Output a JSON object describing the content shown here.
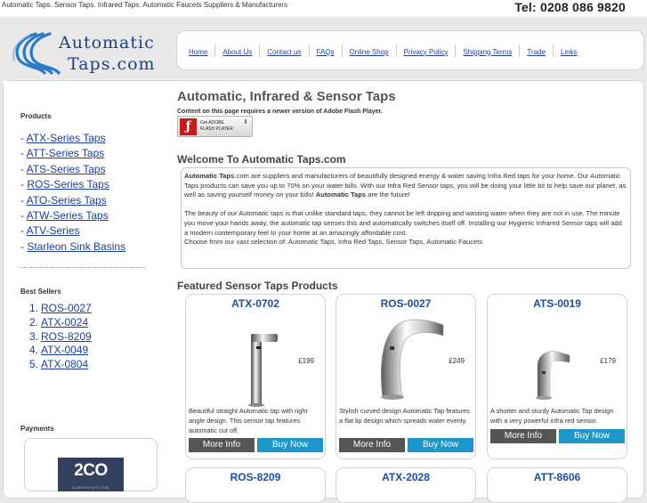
{
  "header": {
    "tagline": "Automatic Taps. Sensor Taps. Infrared Taps. Automatic Faucets Suppliers & Manufacturers",
    "phone": "Tel: 0208 086 9820"
  },
  "logo": {
    "line1": "Automatic",
    "line2": "Taps.com",
    "icon": "water-swoosh-logo"
  },
  "nav": {
    "items": [
      {
        "label": "Home"
      },
      {
        "label": "About Us"
      },
      {
        "label": "Contact us"
      },
      {
        "label": "FAQs"
      },
      {
        "label": "Online Shop"
      },
      {
        "label": "Privacy Policy"
      },
      {
        "label": "Shipping Terms"
      },
      {
        "label": "Trade"
      },
      {
        "label": "Links"
      }
    ]
  },
  "sidebar": {
    "products_title": "Products",
    "products": [
      {
        "prefix": "- ",
        "label": "ATX-Series Taps"
      },
      {
        "prefix": "- ",
        "label": "ATT-Series Taps"
      },
      {
        "prefix": "- ",
        "label": "ATS-Series Taps"
      },
      {
        "prefix": "- ",
        "label": "ROS-Series Taps"
      },
      {
        "prefix": "- ",
        "label": "ATO-Series Taps"
      },
      {
        "prefix": "- ",
        "label": "ATW-Series Taps"
      },
      {
        "prefix": "- ",
        "label": "ATV-Series "
      },
      {
        "prefix": "- ",
        "label": "Starleon Sink Basins"
      }
    ],
    "best_title": "Best Sellers",
    "best": [
      {
        "num": "1.",
        "label": "ROS-0027"
      },
      {
        "num": "2.",
        "label": "ATX-0024"
      },
      {
        "num": "3.",
        "label": "ROS-8209"
      },
      {
        "num": "4.",
        "label": "ATX-0049"
      },
      {
        "num": "5.",
        "label": "ATX-0804"
      }
    ],
    "payments_title": "Payments",
    "payment_logo": "2CO",
    "payment_sub": "2CHECKOUT.COM"
  },
  "main": {
    "title": "Automatic, Infrared & Sensor Taps",
    "flash_note": "Content on this page requires a newer version of Adobe Flash Player.",
    "flash_btn_line1": "Get ADOBE",
    "flash_btn_line2": "FLASH PLAYER",
    "welcome_title": "Welcome To Automatic Taps.com",
    "welcome_bold1": "Automatic Taps",
    "welcome_text1": ".com are suppliers and manufacturers of beautifully designed energy & water saving Infra Red taps for your home. Our Automatic Taps products can save you up to 70% on your water bills. With our Infra Red Sensor taps, you will be doing your little bit to help save our planet, as well as saving yourself money on your bills! ",
    "welcome_bold2": "Automatic Taps",
    "welcome_text2": " are the future!",
    "welcome_p2": "The beauty of our Automatic taps is that unlike standard taps, they cannot be left dripping and wasting water when they are not in use. The minute you move your hands away, the automatic tap senses this and automatically switches itself off. Installing our Hygienic Infrared Sensor taps will add a modern contemporary feel to your home at an amazingly affordable cost.",
    "welcome_p3": "Choose from our vast selection of: Automatic Taps, Infra Red Taps, Sensor Taps, Automatic Faucets",
    "featured_title": "Featured Sensor Taps Products"
  },
  "products": [
    {
      "name": "ATX-0702",
      "price": "£199",
      "desc": "Beautiful straight Automatic tap with right angle design. This sensor tap features automatic cut off.",
      "more": "More Info",
      "buy": "Buy Now"
    },
    {
      "name": "ROS-0027",
      "price": "£249",
      "desc": "Stylish curved design Automatic Tap features a flat lip design which spreads water evenly.",
      "more": "More Info",
      "buy": "Buy Now"
    },
    {
      "name": "ATS-0019",
      "price": "£179",
      "desc": "A shorter and sturdy Automatic Tap design with a very powerful infra red sensor.",
      "more": "More Info",
      "buy": "Buy Now"
    }
  ],
  "products_row2": [
    {
      "name": "ROS-8209"
    },
    {
      "name": "ATX-2028"
    },
    {
      "name": "ATT-8606"
    }
  ]
}
